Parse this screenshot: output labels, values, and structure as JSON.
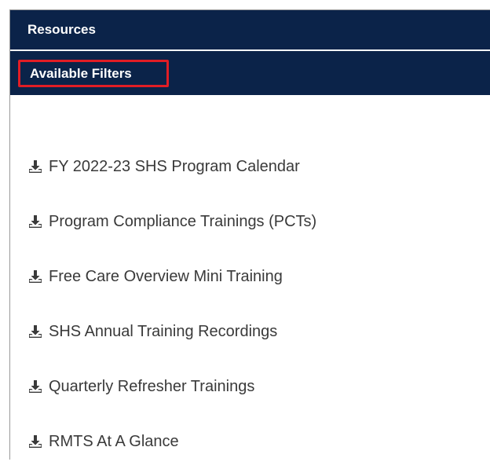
{
  "header": {
    "title": "Resources"
  },
  "filters": {
    "label": "Available Filters"
  },
  "resources": [
    {
      "label": "FY 2022-23 SHS Program Calendar",
      "icon": "download-icon"
    },
    {
      "label": "Program Compliance Trainings (PCTs)",
      "icon": "download-icon"
    },
    {
      "label": "Free Care Overview Mini Training",
      "icon": "download-icon"
    },
    {
      "label": "SHS Annual Training Recordings",
      "icon": "download-icon"
    },
    {
      "label": "Quarterly Refresher Trainings",
      "icon": "download-icon"
    },
    {
      "label": "RMTS At A Glance",
      "icon": "download-icon"
    }
  ],
  "colors": {
    "header_bg": "#0b2349",
    "highlight": "#e11d25",
    "text": "#3a3a3a"
  }
}
